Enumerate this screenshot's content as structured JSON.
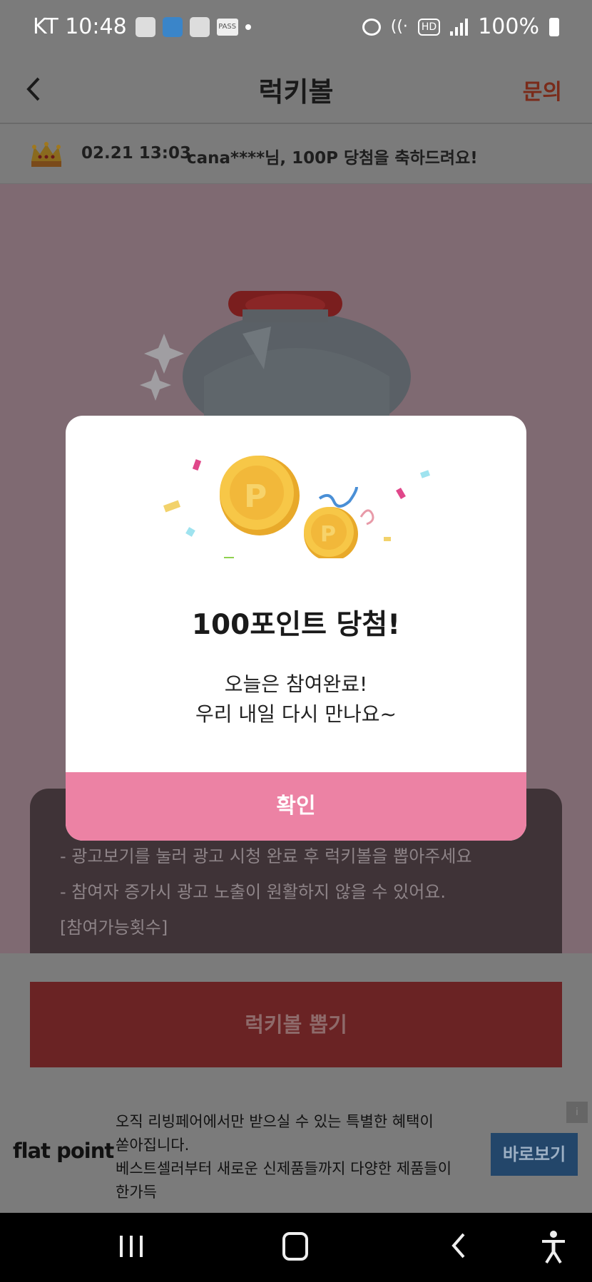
{
  "status_bar": {
    "carrier_time": "KT 10:48",
    "battery": "100%",
    "hd_label": "HD",
    "pass_label": "PASS"
  },
  "header": {
    "title": "럭키볼",
    "inquiry": "문의",
    "back_icon": "chevron-left-icon"
  },
  "winner_banner": {
    "date": "02.21 13:03",
    "message": "cana****님, 100P 당첨을 축하드려요!",
    "icon": "crown-icon"
  },
  "info": {
    "lines": [
      "- 광고보기를 눌러 광고 시청 완료 후 럭키볼을 뽑아주세요",
      "- 참여자 증가시 광고 노출이 원활하지 않을 수 있어요.",
      "[참여가능횟수]"
    ]
  },
  "draw_button": "럭키볼 뽑기",
  "ad": {
    "logo": "flat point",
    "text_lines": [
      "오직 리빙페어에서만 받으실 수 있는 특별한 혜택이",
      "쏟아집니다.",
      "베스트셀러부터 새로운 신제품들까지 다양한 제품들이",
      "한가득"
    ],
    "cta": "바로보기",
    "info_icon": "i"
  },
  "dialog": {
    "title": "100포인트 당첨!",
    "message_line1": "오늘은 참여완료!",
    "message_line2": "우리 내일 다시 만나요~",
    "confirm": "확인",
    "coin_letter": "P"
  },
  "colors": {
    "accent_pink": "#ec82a4",
    "draw_button": "#6a2324",
    "inquiry": "#7a2b1a"
  }
}
